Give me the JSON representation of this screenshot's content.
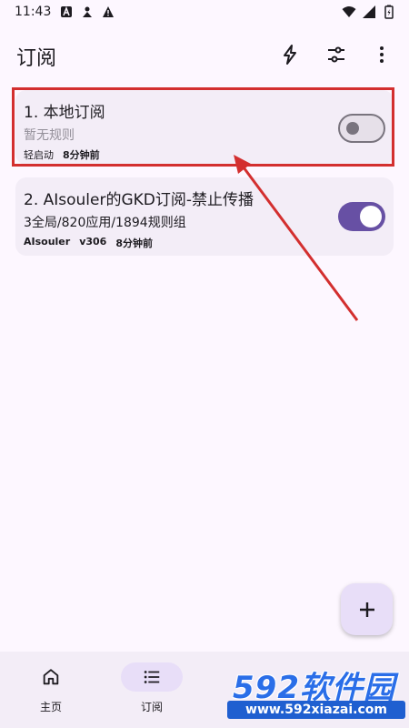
{
  "status_bar": {
    "time": "11:43"
  },
  "top_bar": {
    "title": "订阅"
  },
  "subscriptions": [
    {
      "name": "1. 本地订阅",
      "detail": "暂无规则",
      "meta_a": "轻启动",
      "meta_b": "8分钟前",
      "enabled": false
    },
    {
      "name": "2. AIsouler的GKD订阅-禁止传播",
      "detail": "3全局/820应用/1894规则组",
      "meta_a": "AIsouler",
      "meta_b": "v306",
      "meta_c": "8分钟前",
      "enabled": true
    }
  ],
  "bottom_nav": {
    "items": [
      {
        "label": "主页",
        "icon": "home-icon",
        "active": false
      },
      {
        "label": "订阅",
        "icon": "list-icon",
        "active": true
      }
    ]
  },
  "watermark": {
    "brand": "592软件园",
    "site": "www.592xiazai.com"
  },
  "colors": {
    "accent": "#6750a4",
    "card": "#f3edf7",
    "background": "#fdf7ff",
    "highlight": "#d32f2f"
  }
}
